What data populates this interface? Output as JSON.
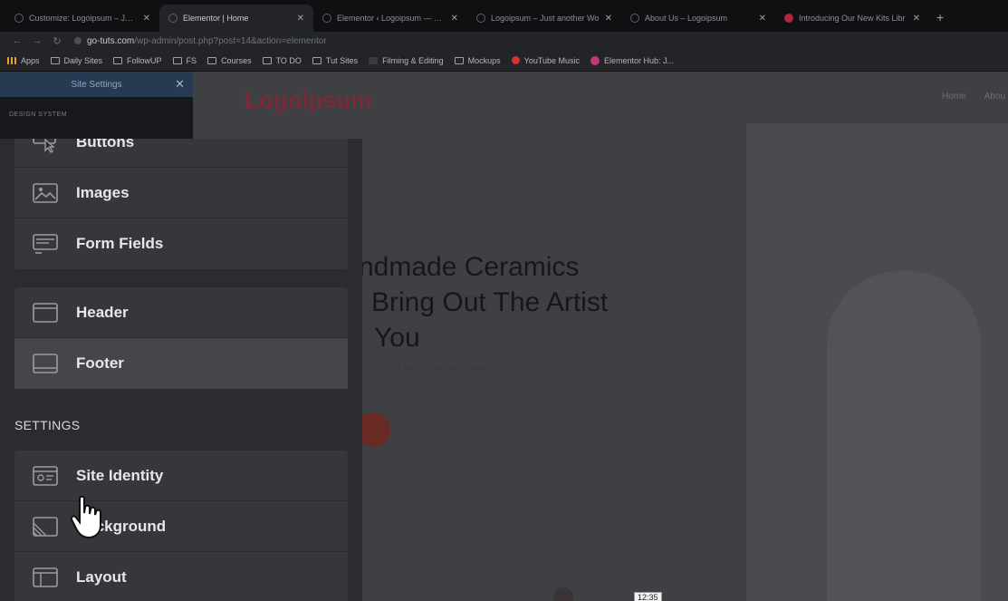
{
  "tabs": [
    {
      "title": "Customize: Logoipsum – Just a",
      "active": false
    },
    {
      "title": "Elementor | Home",
      "active": true
    },
    {
      "title": "Elementor ‹ Logoipsum — Wo",
      "active": false
    },
    {
      "title": "Logoipsum – Just another Wo",
      "active": false
    },
    {
      "title": "About Us – Logoipsum",
      "active": false
    },
    {
      "title": "Introducing Our New Kits Libr",
      "active": false
    }
  ],
  "address": {
    "domain": "go-tuts.com",
    "path": "/wp-admin/post.php?post=14&action=elementor"
  },
  "bookmarks": [
    {
      "label": "Apps",
      "icon": "apps-grid-icon"
    },
    {
      "label": "Daily Sites",
      "icon": "folder-icon"
    },
    {
      "label": "FollowUP",
      "icon": "folder-icon"
    },
    {
      "label": "FS",
      "icon": "folder-icon"
    },
    {
      "label": "Courses",
      "icon": "folder-icon"
    },
    {
      "label": "TO DO",
      "icon": "folder-icon"
    },
    {
      "label": "Tut Sites",
      "icon": "folder-icon"
    },
    {
      "label": "Filming & Editing",
      "icon": "k-icon"
    },
    {
      "label": "Mockups",
      "icon": "folder-icon"
    },
    {
      "label": "YouTube Music",
      "icon": "youtube-music-icon"
    },
    {
      "label": "Elementor Hub: J...",
      "icon": "elementor-icon"
    }
  ],
  "panel": {
    "title": "Site Settings",
    "section_design_system": "DESIGN SYSTEM",
    "theme_style_items": [
      {
        "label": "Buttons",
        "icon": "button-cursor-icon"
      },
      {
        "label": "Images",
        "icon": "image-icon"
      },
      {
        "label": "Form Fields",
        "icon": "form-fields-icon"
      }
    ],
    "layout_items": [
      {
        "label": "Header",
        "icon": "header-icon"
      },
      {
        "label": "Footer",
        "icon": "footer-icon"
      }
    ],
    "settings_title": "SETTINGS",
    "settings_items": [
      {
        "label": "Site Identity",
        "icon": "site-identity-icon"
      },
      {
        "label": "Background",
        "icon": "background-icon"
      },
      {
        "label": "Layout",
        "icon": "layout-icon"
      }
    ]
  },
  "preview": {
    "logo": "Logoipsum",
    "nav": [
      "Home",
      "Abou"
    ],
    "headline": [
      "ndmade Ceramics",
      "Bring Out The Artist",
      "You"
    ],
    "subline": "that will teach you the basics of",
    "timestamp": "12:35"
  },
  "colors": {
    "logo": "#7a2a3b",
    "panel_header": "#283a52",
    "card": "#36373b"
  }
}
